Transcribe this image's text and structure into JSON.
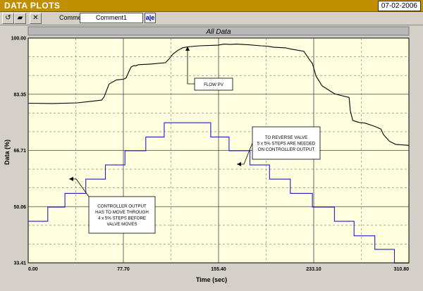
{
  "window": {
    "title": "DATA PLOTS",
    "date": "07-02-2006"
  },
  "toolbar": {
    "undo_icon": "undo-icon",
    "open_icon": "folder-icon",
    "clear_icon": "cross-icon",
    "comment_label": "Comment",
    "comment_value": "Comment1",
    "comment_button_label": "a|e"
  },
  "chart": {
    "header_title": "All Data",
    "colors": {
      "plot_bg": "#ffffe0",
      "header_bg": "#b8b8b8",
      "flow": "#000000",
      "controller": "#2020c8"
    }
  },
  "chart_data": {
    "type": "line",
    "title": "All Data",
    "xlabel": "Time (sec)",
    "ylabel": "Data (%)",
    "xlim": [
      0.0,
      310.8
    ],
    "ylim": [
      33.41,
      100.0
    ],
    "x_ticks": [
      "0.00",
      "77.70",
      "155.40",
      "233.10",
      "310.80"
    ],
    "y_ticks": [
      "33.41",
      "50.06",
      "66.71",
      "83.35",
      "100.00"
    ],
    "grid": true,
    "series": [
      {
        "name": "FLOW PV",
        "x": [
          0,
          20,
          40,
          60,
          62,
          64,
          66,
          72,
          78,
          80,
          82,
          84,
          86,
          88,
          90,
          100,
          112,
          115,
          118,
          122,
          126,
          130,
          140,
          155,
          160,
          165,
          170,
          180,
          190,
          195,
          200,
          205,
          210,
          215,
          225,
          230,
          232,
          235,
          240,
          250,
          255,
          262,
          263,
          265,
          270,
          275,
          280,
          285,
          288,
          290,
          295,
          300,
          310.8
        ],
        "y": [
          80.7,
          80.6,
          80.8,
          81.6,
          82.6,
          84.5,
          86.4,
          87.6,
          87.8,
          88.2,
          89.9,
          91.4,
          91.8,
          91.8,
          92.1,
          92.3,
          92.7,
          93.8,
          95.2,
          96.3,
          97.1,
          97.4,
          97.7,
          97.9,
          98.2,
          98.1,
          98.2,
          98.0,
          97.7,
          97.6,
          97.3,
          97.2,
          97.1,
          96.7,
          96.1,
          93.4,
          92.5,
          88.7,
          85.8,
          83.5,
          83.0,
          82.4,
          78.4,
          75.6,
          75.0,
          74.8,
          74.2,
          73.5,
          73.0,
          71.4,
          69.4,
          68.5,
          68.2
        ]
      },
      {
        "name": "CONTROLLER OUTPUT",
        "x": [
          0,
          16,
          16,
          30,
          30,
          47,
          47,
          63,
          63,
          79,
          79,
          96,
          96,
          111,
          111,
          149,
          149,
          164,
          164,
          181,
          181,
          197,
          197,
          214,
          214,
          232,
          232,
          250,
          250,
          266,
          266,
          283,
          283,
          299,
          299,
          310.8
        ],
        "y": [
          45.7,
          45.7,
          49.9,
          49.9,
          54.0,
          54.0,
          58.2,
          58.2,
          62.4,
          62.4,
          66.6,
          66.6,
          70.7,
          70.7,
          74.9,
          74.9,
          70.7,
          70.7,
          66.6,
          66.6,
          62.4,
          62.4,
          58.2,
          58.2,
          54.0,
          54.0,
          49.9,
          49.9,
          45.7,
          45.7,
          41.4,
          41.4,
          37.4,
          37.4,
          33.3,
          33.3
        ]
      }
    ],
    "annotations": [
      {
        "id": "flow",
        "lines": [
          "FLOW PV"
        ]
      },
      {
        "id": "reverse",
        "lines": [
          "TO REVERSE VALVE",
          "5 x 5% STEPS ARE NEEDED",
          "ON CONTROLLER OUTPUT"
        ]
      },
      {
        "id": "output",
        "lines": [
          "CONTROLLER OUTPUT",
          "HAS TO MOVE THROUGH",
          "4 x 5% STEPS BEFORE",
          "VALVE MOVES"
        ]
      }
    ]
  }
}
